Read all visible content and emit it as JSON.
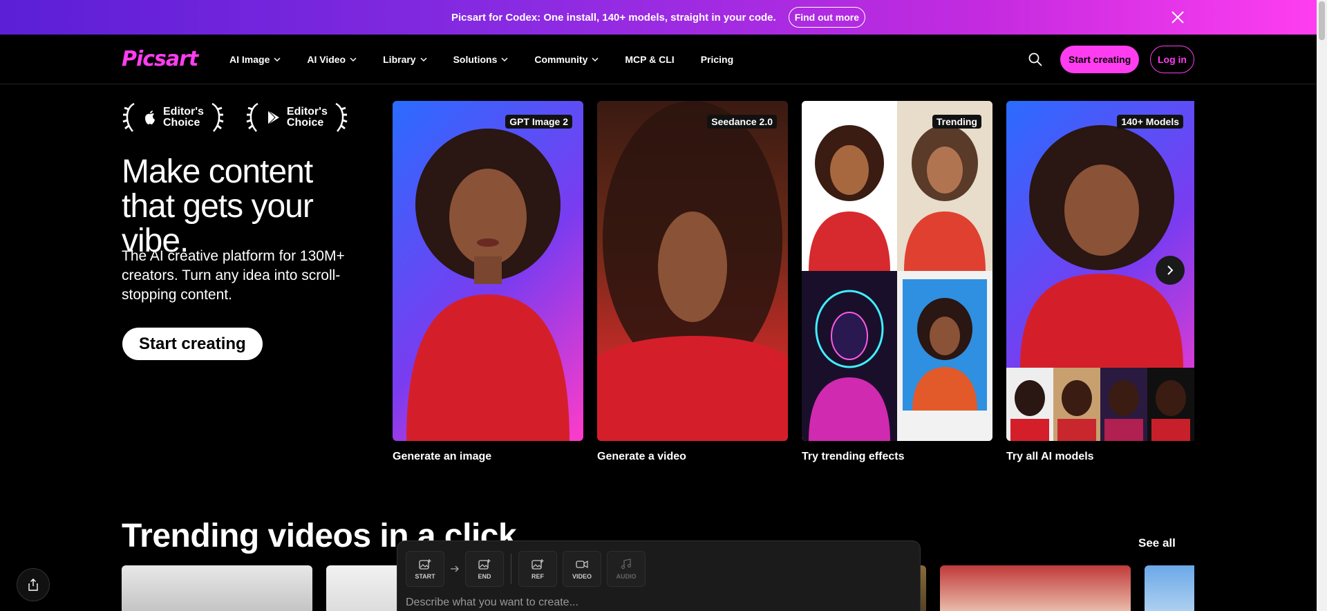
{
  "banner": {
    "text": "Picsart for Codex: One install, 140+ models, straight in your code.",
    "cta": "Find out more"
  },
  "nav": {
    "logo": "Picsart",
    "items": [
      {
        "label": "AI Image",
        "dropdown": true
      },
      {
        "label": "AI Video",
        "dropdown": true
      },
      {
        "label": "Library",
        "dropdown": true
      },
      {
        "label": "Solutions",
        "dropdown": true
      },
      {
        "label": "Community",
        "dropdown": true
      },
      {
        "label": "MCP & CLI",
        "dropdown": false
      },
      {
        "label": "Pricing",
        "dropdown": false
      }
    ],
    "start_label": "Start creating",
    "login_label": "Log in"
  },
  "hero": {
    "awards": [
      {
        "line1": "Editor's",
        "line2": "Choice",
        "icon": "apple-icon"
      },
      {
        "line1": "Editor's",
        "line2": "Choice",
        "icon": "google-play-icon"
      }
    ],
    "title": "Make content that gets your vibe.",
    "subtitle": "The AI creative platform for 130M+ creators. Turn any idea into scroll-stopping content.",
    "cta": "Start creating"
  },
  "cards": [
    {
      "badge": "GPT Image 2",
      "label": "Generate an image"
    },
    {
      "badge": "Seedance 2.0",
      "label": "Generate a video"
    },
    {
      "badge": "Trending",
      "label": "Try trending effects"
    },
    {
      "badge": "140+ Models",
      "label": "Try all AI models"
    }
  ],
  "trending": {
    "title": "Trending videos in a click",
    "see_all": "See all"
  },
  "prompt": {
    "tools": [
      {
        "label": "START",
        "icon": "image-add-icon"
      },
      {
        "label": "END",
        "icon": "image-add-icon"
      },
      {
        "label": "REF",
        "icon": "image-add-icon"
      },
      {
        "label": "VIDEO",
        "icon": "video-icon"
      },
      {
        "label": "AUDIO",
        "icon": "music-icon"
      }
    ],
    "placeholder": "Describe what you want to create..."
  },
  "colors": {
    "accent": "#ff3df0",
    "banner_start": "#5b1fd6",
    "banner_end": "#ff3df0"
  }
}
